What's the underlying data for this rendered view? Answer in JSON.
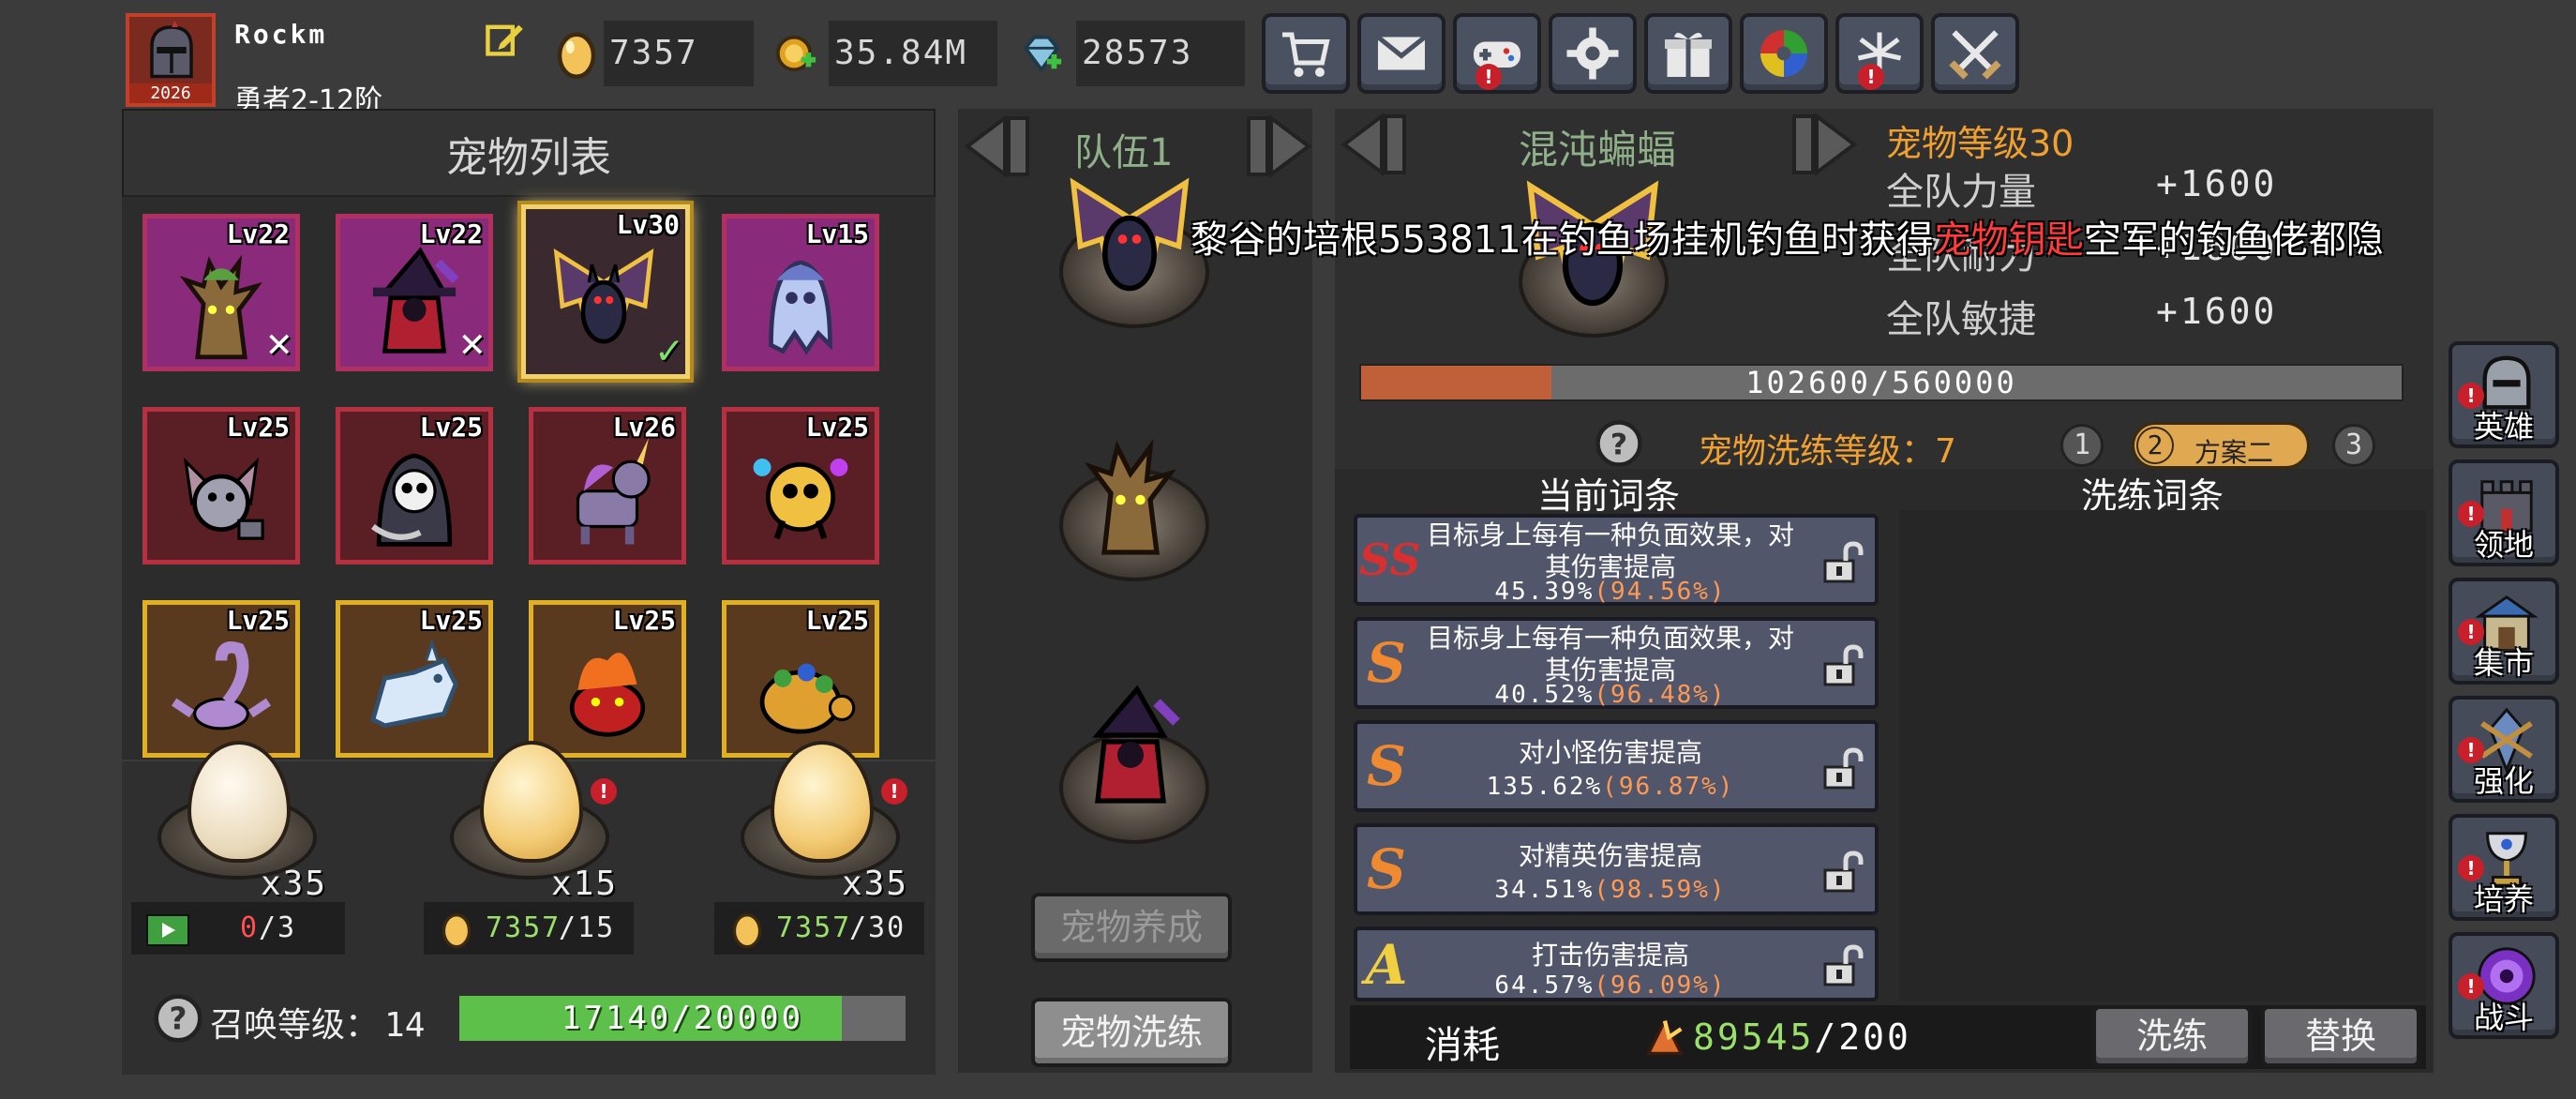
{
  "player": {
    "name": "Rockm",
    "rank": "勇者2-12阶",
    "avatar_tag": "2026"
  },
  "resources": {
    "eggs": "7357",
    "gold": "35.84M",
    "gems": "28573"
  },
  "toolbar": [
    {
      "icon": "cart-icon",
      "alert": false
    },
    {
      "icon": "mail-icon",
      "alert": false
    },
    {
      "icon": "gamepad-icon",
      "alert": true
    },
    {
      "icon": "gear-icon",
      "alert": false
    },
    {
      "icon": "gift-icon",
      "alert": false
    },
    {
      "icon": "color-wheel-icon",
      "alert": false
    },
    {
      "icon": "fireworks-icon",
      "alert": true
    },
    {
      "icon": "crossed-swords-icon",
      "alert": false
    }
  ],
  "pet_list": {
    "title": "宠物列表",
    "pets": [
      {
        "level": "Lv22",
        "rarity": "purple",
        "mark": "✕",
        "kind": "treant"
      },
      {
        "level": "Lv22",
        "rarity": "purple",
        "mark": "✕",
        "kind": "witch"
      },
      {
        "level": "Lv30",
        "rarity": "purple",
        "mark": "✓",
        "kind": "bat",
        "selected": true
      },
      {
        "level": "Lv15",
        "rarity": "purple",
        "mark": "",
        "kind": "ghost"
      },
      {
        "level": "Lv25",
        "rarity": "red",
        "mark": "",
        "kind": "hammer-bat"
      },
      {
        "level": "Lv25",
        "rarity": "red",
        "mark": "",
        "kind": "reaper"
      },
      {
        "level": "Lv26",
        "rarity": "red",
        "mark": "",
        "kind": "unicorn"
      },
      {
        "level": "Lv25",
        "rarity": "red",
        "mark": "",
        "kind": "skull-lantern"
      },
      {
        "level": "Lv25",
        "rarity": "gold",
        "mark": "",
        "kind": "scorpion"
      },
      {
        "level": "Lv25",
        "rarity": "gold",
        "mark": "",
        "kind": "ice-wolf"
      },
      {
        "level": "Lv25",
        "rarity": "gold",
        "mark": "",
        "kind": "fire-beast"
      },
      {
        "level": "Lv25",
        "rarity": "gold",
        "mark": "",
        "kind": "turtle"
      }
    ]
  },
  "summon": {
    "eggs": [
      {
        "count": "x35",
        "cost_label": "0",
        "cost_max": "/3",
        "cost_type": "video-ad"
      },
      {
        "count": "x15",
        "cost_label": "7357",
        "cost_max": "/15",
        "cost_type": "egg"
      },
      {
        "count": "x35",
        "cost_label": "7357",
        "cost_max": "/30",
        "cost_type": "egg"
      }
    ],
    "level_label": "召唤等级：",
    "level": "14",
    "progress_text": "17140/20000",
    "progress": 0.857
  },
  "team": {
    "label": "队伍1",
    "buttons": {
      "nurture": "宠物养成",
      "refine": "宠物洗练"
    }
  },
  "pet_detail": {
    "name": "混沌蝙蝠",
    "level_text": "宠物等级30",
    "stats": [
      {
        "label": "全队力量",
        "value": "+1600"
      },
      {
        "label": "全队耐力",
        "value": "+1600"
      },
      {
        "label": "全队敏捷",
        "value": "+1600"
      }
    ],
    "exp_text": "102600/560000",
    "exp": 0.183
  },
  "broadcast": {
    "prefix": "黎谷的培根553811",
    "middle": "在钓鱼场挂机钓鱼时获得",
    "highlight": "宠物钥匙",
    "suffix": "空军的钓鱼佬都隐"
  },
  "refine": {
    "level_text": "宠物洗练等级：7",
    "plans": [
      {
        "label": "1"
      },
      {
        "label": "2",
        "name": "方案二"
      },
      {
        "label": "3"
      }
    ],
    "current_header": "当前词条",
    "refine_header": "洗练词条",
    "affixes": [
      {
        "grade": "SS",
        "title": "目标身上每有一种负面效果，对其伤害提高",
        "value": "45.39%",
        "pct": "(94.56%)"
      },
      {
        "grade": "S",
        "title": "目标身上每有一种负面效果，对其伤害提高",
        "value": "40.52%",
        "pct": "(96.48%)"
      },
      {
        "grade": "S",
        "title": "对小怪伤害提高",
        "value": "135.62%",
        "pct": "(96.87%)"
      },
      {
        "grade": "S",
        "title": "对精英伤害提高",
        "value": "34.51%",
        "pct": "(98.59%)"
      },
      {
        "grade": "A",
        "title": "打击伤害提高",
        "value": "64.57%",
        "pct": "(96.09%)"
      }
    ],
    "cost_label": "消耗",
    "cost_have": "89545",
    "cost_need": "/200",
    "refine_button": "洗练",
    "replace_button": "替换"
  },
  "sidebar": [
    {
      "label": "英雄",
      "icon": "helmet-icon"
    },
    {
      "label": "领地",
      "icon": "castle-icon"
    },
    {
      "label": "集市",
      "icon": "market-icon"
    },
    {
      "label": "强化",
      "icon": "crystal-icon"
    },
    {
      "label": "培养",
      "icon": "chalice-icon"
    },
    {
      "label": "战斗",
      "icon": "portal-icon"
    }
  ],
  "colors": {
    "accent_gold": "#f0a030",
    "exp_bar": "#c0603a",
    "summon_bar": "#5cc04a",
    "danger": "#ff3b3b"
  }
}
